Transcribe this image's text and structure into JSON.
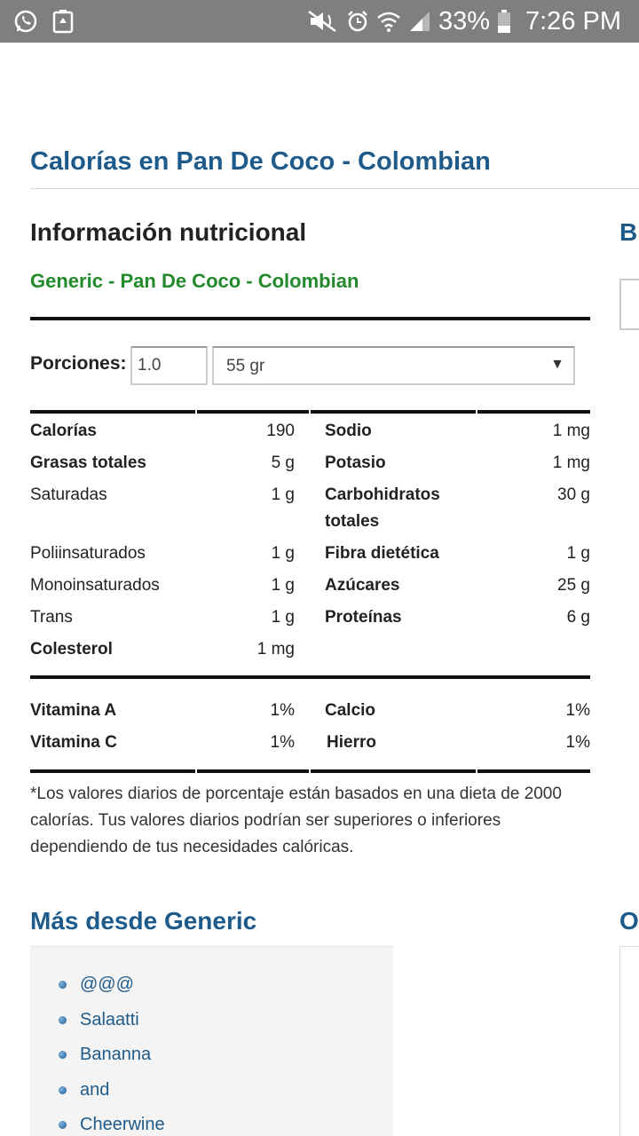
{
  "status_bar": {
    "battery": "33%",
    "time": "7:26 PM",
    "icons": [
      "whatsapp-icon",
      "recycle-icon",
      "mute-icon",
      "alarm-icon",
      "wifi-icon",
      "signal-icon",
      "battery-icon"
    ]
  },
  "page": {
    "title": "Calorías en Pan De Coco - Colombian",
    "section_title": "Información nutricional",
    "subtitle": "Generic - Pan De Coco - Colombian",
    "side_title_1": "Bu",
    "side_title_2": "Ot"
  },
  "servings": {
    "label": "Porciones:",
    "quantity": "1.0",
    "unit": "55 gr"
  },
  "nutrition": {
    "rows": [
      {
        "left_label": "Calorías",
        "left_value": "190",
        "left_bold": true,
        "right_label": "Sodio",
        "right_value": "1 mg",
        "right_bold": true
      },
      {
        "left_label": "Grasas totales",
        "left_value": "5 g",
        "left_bold": true,
        "right_label": "Potasio",
        "right_value": "1 mg",
        "right_bold": true
      },
      {
        "left_label": "Saturadas",
        "left_value": "1 g",
        "left_bold": false,
        "right_label": "Carbohidratos totales",
        "right_value": "30 g",
        "right_bold": true
      },
      {
        "left_label": "Poliinsaturados",
        "left_value": "1 g",
        "left_bold": false,
        "right_label": "Fibra dietética",
        "right_value": "1 g",
        "right_bold": true
      },
      {
        "left_label": "Monoinsaturados",
        "left_value": "1 g",
        "left_bold": false,
        "right_label": "Azúcares",
        "right_value": "25 g",
        "right_bold": true
      },
      {
        "left_label": "Trans",
        "left_value": "1 g",
        "left_bold": false,
        "right_label": "Proteínas",
        "right_value": "6 g",
        "right_bold": true
      },
      {
        "left_label": "Colesterol",
        "left_value": "1 mg",
        "left_bold": true,
        "right_label": "",
        "right_value": "",
        "right_bold": true
      }
    ],
    "vitamins": [
      {
        "left_label": "Vitamina A",
        "left_value": "1%",
        "right_label": "Calcio",
        "right_value": "1%"
      },
      {
        "left_label": "Vitamina C",
        "left_value": "1%",
        "right_label": "Hierro",
        "right_value": "1%"
      }
    ]
  },
  "disclaimer": "*Los valores diarios de porcentaje están basados en una dieta de 2000 calorías. Tus valores diarios podrían ser superiores o inferiores dependiendo de tus necesidades calóricas.",
  "more": {
    "title": "Más desde Generic",
    "items": [
      "@@@",
      "Salaatti",
      "Bananna",
      "and",
      "Cheerwine"
    ]
  },
  "colors": {
    "link_blue": "#1e5a8a",
    "brand_green": "#238a2c",
    "status_bar": "#7f7f7f"
  }
}
